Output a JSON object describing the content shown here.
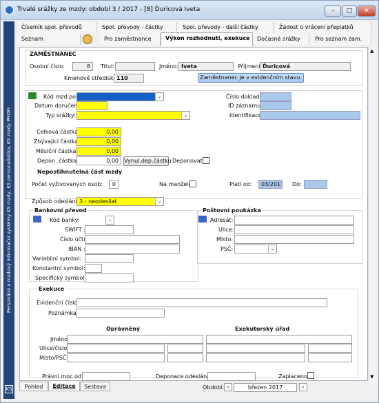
{
  "window": {
    "title": "Trvalé srážky ze mzdy: období 3 / 2017 - [8] Ďuricová Iveta",
    "btn_min": "–",
    "btn_max": "□",
    "btn_close": "✕"
  },
  "sidebar": {
    "text": "Personální a mzdový informační systémy KS mzdy, KS personalistika, KS mzdy PROFI",
    "logo": "KS"
  },
  "tabs_row1": [
    "Číselník spol. převodů",
    "Spol. převody - částky",
    "Spol. převody - další částky",
    "Žádost o vrácení přeplatků"
  ],
  "tabs_row2": [
    "Seznam zaměstnanců",
    "Pro zaměstnance",
    "Výkon rozhodnutí, exekuce",
    "Dočasné srážky",
    "Pro seznam zam."
  ],
  "employee": {
    "section": "ZAMĚSTNANEC",
    "osobni_label": "Osobní číslo:",
    "osobni": "8",
    "titul_label": "Titul:",
    "titul": "",
    "jmeno_label": "Jméno:",
    "jmeno": "Iveta",
    "prijmeni_label": "Příjmení:",
    "prijmeni": "Ďuricová",
    "ks_label": "Kmenové středisko:",
    "ks": "110",
    "status_button": "Zaměstnanec je v evidenčním stavu."
  },
  "form": {
    "kod_label": "Kód mzd.pol.:",
    "kod": "",
    "datum_label": "Datum doručení:",
    "datum": "",
    "typ_label": "Typ srážky:",
    "typ": "",
    "cislo_dokladu_label": "Číslo dokladu:",
    "cislo_dokladu": "",
    "id_label": "ID záznamu:",
    "id": "",
    "ident_label": "Identifikace:",
    "ident": "",
    "celkova_label": "Celková částka:",
    "celkova": "0,00",
    "zbyvajici_label": "Zbývající částka:",
    "zbyvajici": "0,00",
    "mesicni_label": "Měsíční částka:",
    "mesicni": "0,00",
    "depon_label": "Depon. částka:",
    "depon": "0,00",
    "vynul_button": "Vynul.dep.částku",
    "deponovat_label": "Deponovat",
    "nepostizitelna_title": "Nepostihnutelná část mzdy",
    "pocet_label": "Počet vyživovaných osob:",
    "pocet": "0",
    "manzela_label": "Na manžela",
    "plati_od_label": "Platí od:",
    "plati_od": "03/2017",
    "do_label": "Do:",
    "do": "",
    "zpusob_label": "Způsob odeslání:",
    "zpusob": "3 - neodesílat"
  },
  "bank": {
    "title": "Bankovní převod",
    "kod_label": "Kód banky:",
    "swift_label": "SWIFT :",
    "cislo_uctu_label": "Číslo účtu:",
    "iban_label": "IBAN :",
    "var_label": "Variabilní symbol:",
    "konst_label": "Konstantní symbol:",
    "spec_label": "Specifický symbol:"
  },
  "post": {
    "title": "Poštovní poukázka",
    "adresat_label": "Adresát:",
    "ulice_label": "Ulice:",
    "misto_label": "Místo:",
    "psc_label": "PSČ:"
  },
  "exekuce": {
    "title": "Exekuce",
    "evid_label": "Evidenční číslo:",
    "poznamka_label": "Poznámka:",
    "opravneny_title": "Oprávněný",
    "urad_title": "Exekutorský úřad",
    "jmeno_label": "Jméno:",
    "ulice_label": "Ulice/číslo:",
    "misto_label": "Místo/PSČ:",
    "pravni_label": "Právní moc od:",
    "deponace_label": "Deponace odeslána:",
    "zaplaceno_label": "Zaplaceno:"
  },
  "bottom": {
    "tabs": [
      "Pohled",
      "Editace",
      "Sestava"
    ],
    "obdobi_label": "Období:",
    "obdobi": "březen 2017",
    "prev": "‹",
    "next": "›"
  },
  "colors": {
    "required": "#ffff00",
    "highlight": "#1560c8",
    "readonly_blue": "#a8c8ec",
    "sidebar": "#24457a"
  }
}
